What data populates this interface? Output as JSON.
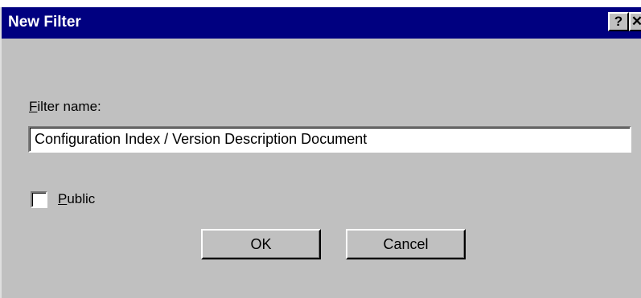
{
  "window": {
    "title": "New Filter",
    "help_glyph": "?",
    "close_glyph": "✕"
  },
  "form": {
    "filter_name_mnemonic": "F",
    "filter_name_rest": "ilter name:",
    "filter_name_value": "Configuration Index / Version Description Document",
    "public_checked": false,
    "public_mnemonic": "P",
    "public_rest": "ublic"
  },
  "buttons": {
    "ok_label": "OK",
    "cancel_label": "Cancel"
  },
  "colors": {
    "titlebar": "#000080",
    "face": "#c0c0c0"
  }
}
